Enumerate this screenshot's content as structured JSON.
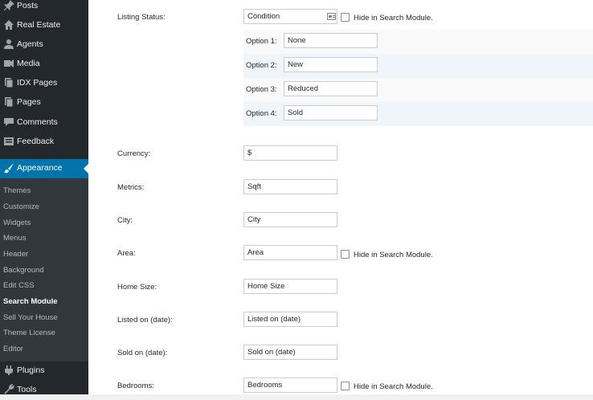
{
  "sidebar": {
    "posts": "Posts",
    "real_estate": "Real Estate",
    "agents": "Agents",
    "media": "Media",
    "idx_pages": "IDX Pages",
    "pages": "Pages",
    "comments": "Comments",
    "feedback": "Feedback",
    "appearance": "Appearance",
    "plugins": "Plugins",
    "tools": "Tools",
    "submenu": {
      "themes": "Themes",
      "customize": "Customize",
      "widgets": "Widgets",
      "menus": "Menus",
      "header": "Header",
      "background": "Background",
      "edit_css": "Edit CSS",
      "search_module": "Search Module",
      "sell_your_house": "Sell Your House",
      "theme_license": "Theme License",
      "editor": "Editor"
    }
  },
  "form": {
    "hide_label": "Hide in Search Module.",
    "listing_status": {
      "label": "Listing Status:",
      "value": "Condition",
      "options": [
        {
          "label": "Option 1:",
          "value": "None"
        },
        {
          "label": "Option 2:",
          "value": "New"
        },
        {
          "label": "Option 3:",
          "value": "Reduced"
        },
        {
          "label": "Option 4:",
          "value": "Sold"
        }
      ]
    },
    "currency": {
      "label": "Currency:",
      "value": "$"
    },
    "metrics": {
      "label": "Metrics:",
      "value": "Sqft"
    },
    "city": {
      "label": "City:",
      "value": "City"
    },
    "area": {
      "label": "Area:",
      "value": "Area"
    },
    "home_size": {
      "label": "Home Size:",
      "value": "Home Size"
    },
    "listed_on": {
      "label": "Listed on (date):",
      "value": "Listed on (date)"
    },
    "sold_on": {
      "label": "Sold on (date):",
      "value": "Sold on (date)"
    },
    "bedrooms": {
      "label": "Bedrooms:",
      "value": "Bedrooms"
    }
  }
}
